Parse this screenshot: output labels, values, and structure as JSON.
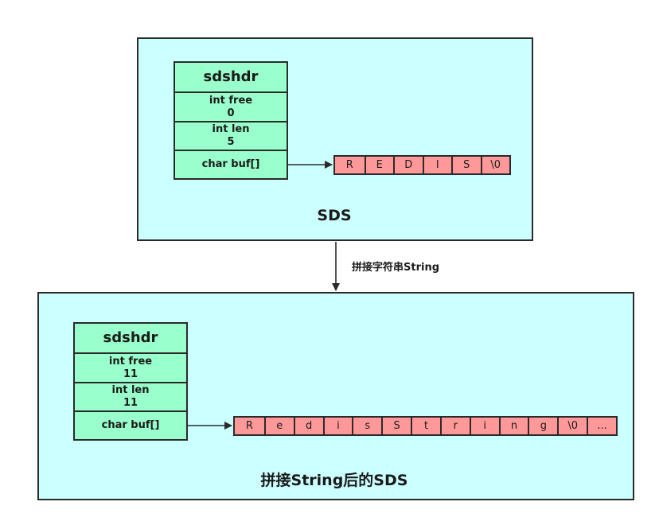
{
  "top": {
    "struct": {
      "title": "sdshdr",
      "free_label": "int free",
      "free_value": "0",
      "len_label": "int len",
      "len_value": "5",
      "buf_label": "char buf[]"
    },
    "buffer": [
      "R",
      "E",
      "D",
      "I",
      "S",
      "\\0"
    ],
    "caption": "SDS"
  },
  "transition": {
    "label": "拼接字符串String"
  },
  "bottom": {
    "struct": {
      "title": "sdshdr",
      "free_label": "int free",
      "free_value": "11",
      "len_label": "int len",
      "len_value": "11",
      "buf_label": "char buf[]"
    },
    "buffer": [
      "R",
      "e",
      "d",
      "i",
      "s",
      "S",
      "t",
      "r",
      "i",
      "n",
      "g",
      "\\0",
      "..."
    ],
    "caption": "拼接String后的SDS"
  },
  "colors": {
    "panel": "#ccffff",
    "struct": "#99ffcc",
    "buffer": "#ff9999",
    "stroke": "#2a2a2a"
  }
}
